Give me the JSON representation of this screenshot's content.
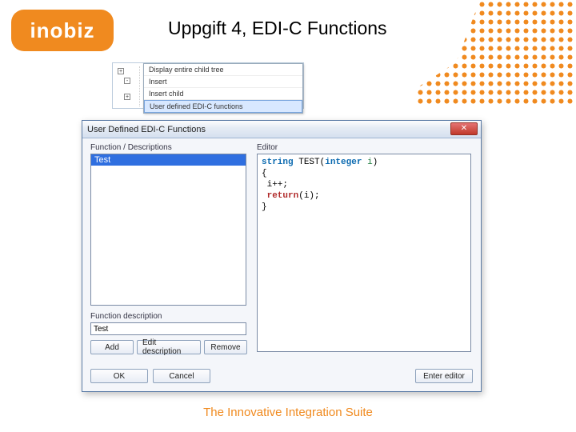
{
  "logo_text": "inobiz",
  "slide_title": "Uppgift 4,  EDI-C Functions",
  "tagline": "The Innovative Integration Suite",
  "context_menu": {
    "items": [
      "Display entire child tree",
      "Insert",
      "Insert child",
      "User defined EDI-C functions"
    ],
    "selected_index": 3
  },
  "dialog": {
    "title": "User Defined EDI-C Functions",
    "close_glyph": "✕",
    "left": {
      "list_label": "Function / Descriptions",
      "items": [
        "Test"
      ],
      "selected_index": 0,
      "desc_label": "Function description",
      "desc_value": "Test",
      "buttons": {
        "add": "Add",
        "edit": "Edit description",
        "remove": "Remove"
      }
    },
    "right": {
      "editor_label": "Editor",
      "code": {
        "kw_string": "string",
        "fn_name": "TEST",
        "kw_integer": "integer",
        "param": "i",
        "stmt": "i++;",
        "kw_return": "return",
        "ret_expr": "(i);"
      },
      "enter_editor": "Enter editor"
    },
    "bottom": {
      "ok": "OK",
      "cancel": "Cancel"
    }
  }
}
